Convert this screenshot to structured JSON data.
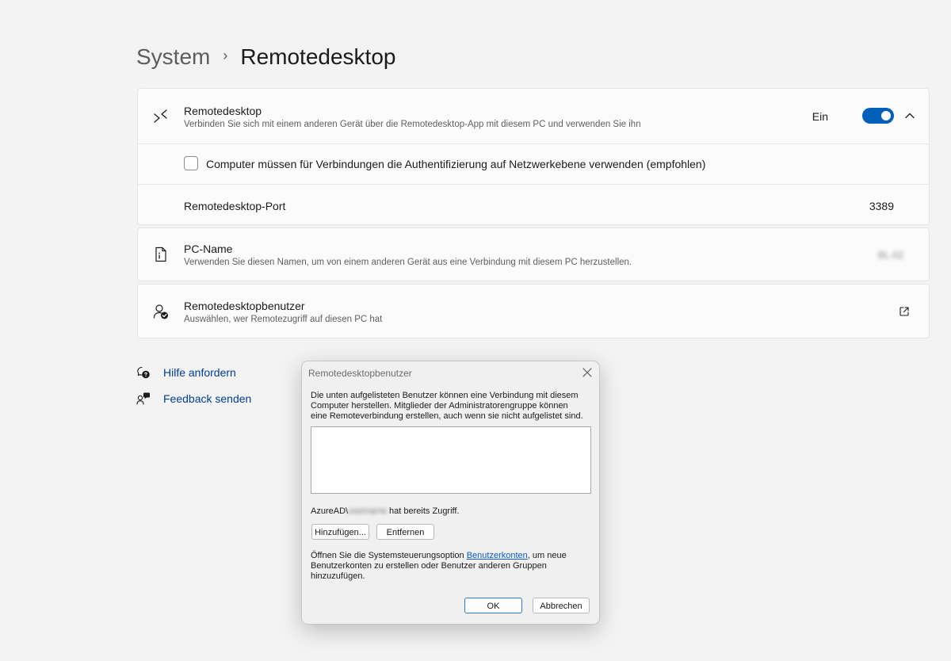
{
  "breadcrumb": {
    "parent": "System",
    "separator": "›",
    "current": "Remotedesktop"
  },
  "remote_desktop": {
    "title": "Remotedesktop",
    "description": "Verbinden Sie sich mit einem anderen Gerät über die Remotedesktop-App mit diesem PC und verwenden Sie ihn",
    "toggle_label": "Ein",
    "toggle_on": true,
    "nla_label": "Computer müssen für Verbindungen die Authentifizierung auf Netzwerkebene verwenden (empfohlen)",
    "nla_checked": false,
    "port_label": "Remotedesktop-Port",
    "port_value": "3389"
  },
  "pc_name": {
    "title": "PC-Name",
    "description": "Verwenden Sie diesen Namen, um von einem anderen Gerät aus eine Verbindung mit diesem PC herzustellen.",
    "value": "BL-02"
  },
  "remote_users": {
    "title": "Remotedesktopbenutzer",
    "description": "Auswählen, wer Remotezugriff auf diesen PC hat"
  },
  "links": {
    "help": "Hilfe anfordern",
    "feedback": "Feedback senden"
  },
  "dialog": {
    "title": "Remotedesktopbenutzer",
    "intro": "Die unten aufgelisteten Benutzer können eine Verbindung mit diesem Computer herstellen. Mitglieder der Administratorengruppe können eine Remoteverbindung erstellen, auch wenn sie nicht aufgelistet sind.",
    "access_prefix": "AzureAD\\",
    "access_user": "username",
    "access_suffix": " hat bereits Zugriff.",
    "add_button": "Hinzufügen...",
    "remove_button": "Entfernen",
    "info_prefix": "Öffnen Sie die Systemsteuerungsoption ",
    "info_link": "Benutzerkonten",
    "info_suffix": ", um neue Benutzerkonten zu erstellen oder Benutzer anderen Gruppen hinzuzufügen.",
    "ok_button": "OK",
    "cancel_button": "Abbrechen"
  },
  "colors": {
    "accent": "#005fb8",
    "link": "#003e92",
    "page_bg": "#f3f3f3"
  },
  "icons": {
    "remote_desktop": "remote-desktop-icon",
    "pc_name": "pc-info-icon",
    "remote_users": "user-check-icon",
    "help": "help-chat-icon",
    "feedback": "feedback-icon",
    "open_external": "open-external-icon",
    "collapse": "chevron-up-icon",
    "close": "close-icon"
  }
}
